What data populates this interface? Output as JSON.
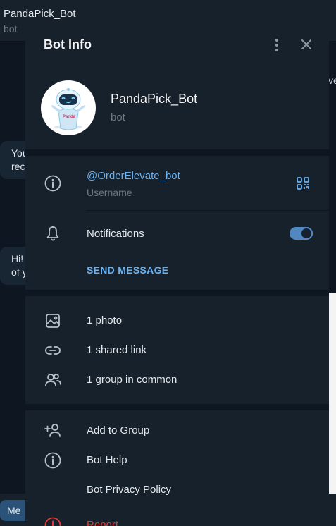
{
  "background": {
    "chat_title": "PandaPick_Bot",
    "chat_subtitle": "bot",
    "bubble1_text": "You\nrec",
    "bubble2_text": "Hi!\nof y",
    "right_fragment": "ve",
    "menu_button_label": "Me"
  },
  "modal": {
    "title": "Bot Info",
    "more_icon": "more-vertical-icon",
    "close_icon": "close-icon"
  },
  "profile": {
    "name": "PandaPick_Bot",
    "subtitle": "bot",
    "avatar_badge": "Panda"
  },
  "info": {
    "username": "@OrderElevate_bot",
    "username_label": "Username",
    "notifications_label": "Notifications",
    "notifications_enabled": true,
    "send_message_label": "SEND MESSAGE"
  },
  "media": {
    "photos": "1 photo",
    "links": "1 shared link",
    "groups": "1 group in common"
  },
  "actions": {
    "add_to_group": "Add to Group",
    "bot_help": "Bot Help",
    "privacy_policy": "Bot Privacy Policy",
    "report": "Report"
  },
  "colors": {
    "accent": "#6ab2f2",
    "toggle": "#5288c1",
    "danger": "#e53935",
    "panel": "#17212b",
    "background": "#0e1621"
  }
}
